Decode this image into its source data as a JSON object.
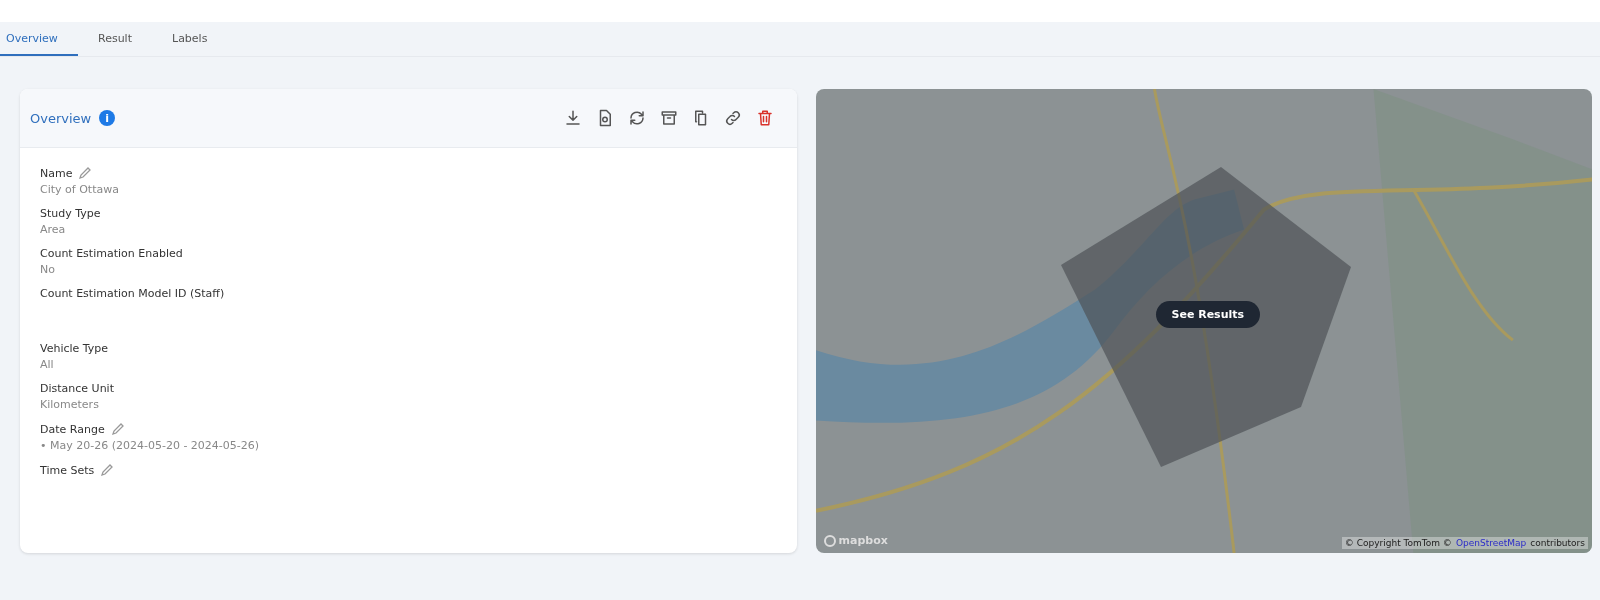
{
  "tabs": [
    {
      "label": "Overview",
      "selected": true
    },
    {
      "label": "Result",
      "selected": false
    },
    {
      "label": "Labels",
      "selected": false
    }
  ],
  "overview": {
    "title": "Overview",
    "info_icon": "i",
    "actions": [
      {
        "kind": "download",
        "danger": false
      },
      {
        "kind": "document",
        "danger": false
      },
      {
        "kind": "refresh",
        "danger": false
      },
      {
        "kind": "archive",
        "danger": false
      },
      {
        "kind": "copy",
        "danger": false
      },
      {
        "kind": "link",
        "danger": false
      },
      {
        "kind": "delete",
        "danger": true
      }
    ],
    "fields": [
      {
        "label": "Name",
        "value": "City of Ottawa",
        "editable": true
      },
      {
        "label": "Study Type",
        "value": "Area",
        "editable": false
      },
      {
        "label": "Count Estimation Enabled",
        "value": "No",
        "editable": false
      },
      {
        "label": "Count Estimation Model ID (Staff)",
        "editable": false
      },
      {
        "label": "Vehicle Type",
        "value": "All",
        "editable": false
      },
      {
        "label": "Distance Unit",
        "value": "Kilometers",
        "editable": false
      },
      {
        "label": "Date Range",
        "value": "• May 20-26 (2024-05-20 - 2024-05-26)",
        "editable": true
      },
      {
        "label": "Time Sets",
        "editable": true
      }
    ]
  },
  "map": {
    "button": "See Results",
    "logo": "mapbox",
    "attribution": "© Copyright TomTom ©",
    "attribution_link": "OpenStreetMap",
    "attribution_end": "contributors"
  }
}
